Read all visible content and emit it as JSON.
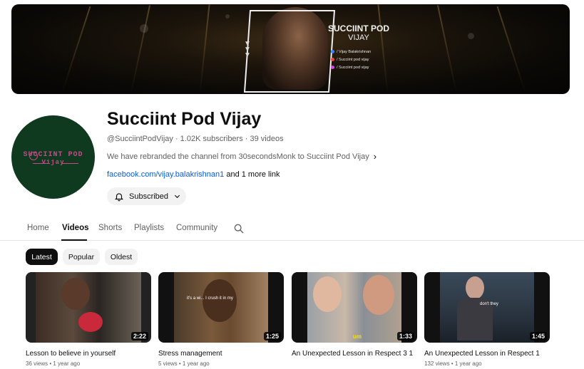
{
  "banner": {
    "title_line1": "SUCCIINT POD",
    "title_line2": "VIJAY",
    "social": [
      {
        "label": "/ Vijay Balakrishnan",
        "color": "#3b82f6"
      },
      {
        "label": "/ Succiint pod vijay",
        "color": "#ef4444"
      },
      {
        "label": "/ Succiint pod vijay",
        "color": "#d946ef"
      }
    ]
  },
  "avatar": {
    "line1": "SUCCIINT POD",
    "line2": "Vijay"
  },
  "channel": {
    "name": "Succiint Pod Vijay",
    "meta": "@SucciintPodVijay · 1.02K subscribers · 39 videos",
    "description": "We have rebranded the channel from 30secondsMonk to Succiint Pod Vijay",
    "link": "facebook.com/vijay.balakrishnan1",
    "more_links": "and 1 more link",
    "subscribe_label": "Subscribed"
  },
  "tabs": [
    {
      "label": "Home"
    },
    {
      "label": "Videos"
    },
    {
      "label": "Shorts"
    },
    {
      "label": "Playlists"
    },
    {
      "label": "Community"
    }
  ],
  "active_tab": "Videos",
  "chips": [
    {
      "label": "Latest"
    },
    {
      "label": "Popular"
    },
    {
      "label": "Oldest"
    }
  ],
  "videos": [
    {
      "title": "Lesson to believe in yourself",
      "meta": "36 views • 1 year ago",
      "duration": "2:22",
      "caption": ""
    },
    {
      "title": "Stress management",
      "meta": "5 views • 1 year ago",
      "duration": "1:25",
      "caption": "it's a wi... I crush it in my"
    },
    {
      "title": "An Unexpected Lesson in Respect 3 1",
      "meta": "",
      "duration": "1:33",
      "caption": "um"
    },
    {
      "title": "An Unexpected Lesson in Respect 1",
      "meta": "132 views • 1 year ago",
      "duration": "1:45",
      "caption": "don't they"
    }
  ],
  "colors": {
    "link": "#065fd4",
    "avatar_bg": "#0f3a1f",
    "logo": "#c24a86"
  }
}
